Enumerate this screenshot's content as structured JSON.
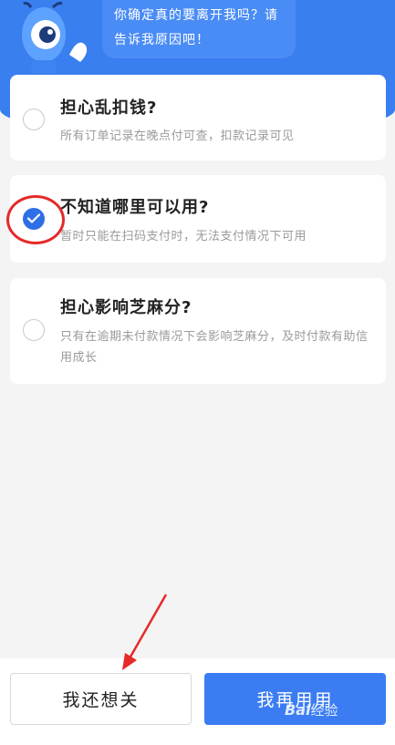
{
  "header": {
    "bubble_line1": "你确定真的要离开我吗？请",
    "bubble_line2": "告诉我原因吧！"
  },
  "options": [
    {
      "title": "担心乱扣钱?",
      "desc": "所有订单记录在晚点付可查，扣款记录可见",
      "checked": false
    },
    {
      "title": "不知道哪里可以用?",
      "desc": "暂时只能在扫码支付时，无法支付情况下可用",
      "checked": true
    },
    {
      "title": "担心影响芝麻分?",
      "desc": "只有在逾期未付款情况下会影响芝麻分，及时付款有助信用成长",
      "checked": false
    }
  ],
  "footer": {
    "close_label": "我还想关",
    "keep_label": "我再用用"
  },
  "watermark": {
    "brand": "Bai",
    "suffix": "经验"
  },
  "colors": {
    "brand_blue": "#3a7ff0",
    "check_blue": "#2f6fe5",
    "annotation_red": "#e52a2a"
  }
}
